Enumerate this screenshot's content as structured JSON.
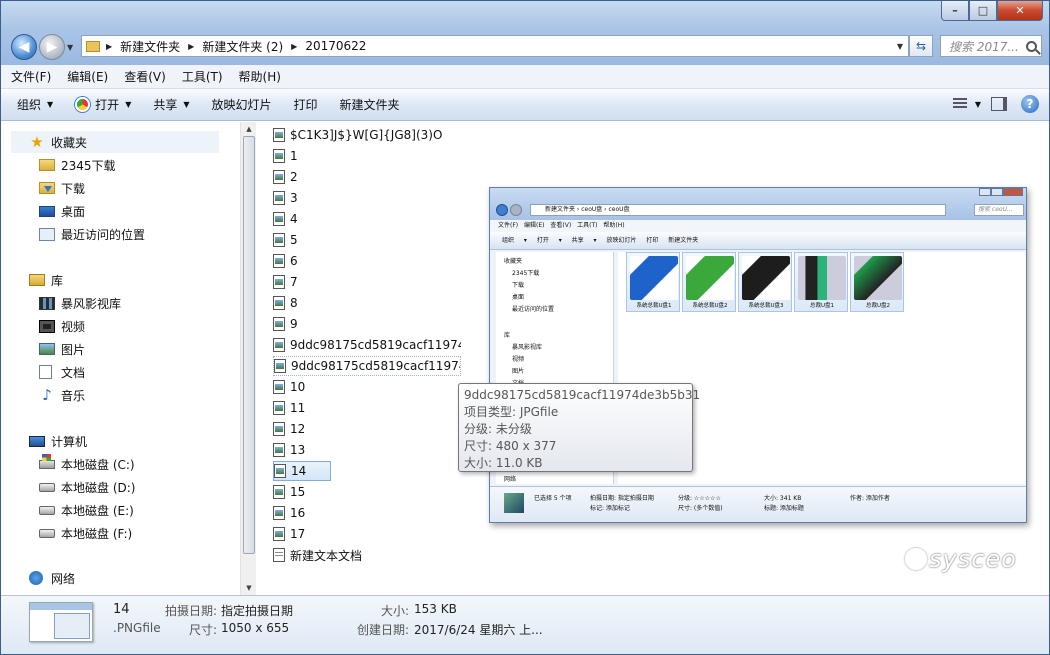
{
  "window": {
    "controls": {
      "minimize": "–",
      "maximize": "□",
      "close": "✕"
    }
  },
  "nav": {
    "back_icon": "back-arrow-icon",
    "forward_icon": "forward-arrow-icon",
    "address": [
      "新建文件夹",
      "新建文件夹 (2)",
      "20170622"
    ],
    "search_placeholder": "搜索 2017..."
  },
  "menu": [
    "文件(F)",
    "编辑(E)",
    "查看(V)",
    "工具(T)",
    "帮助(H)"
  ],
  "commands": {
    "organize": "组织",
    "open": "打开",
    "share": "共享",
    "slideshow": "放映幻灯片",
    "print": "打印",
    "new_folder": "新建文件夹"
  },
  "sidebar": {
    "favorites": {
      "title": "收藏夹",
      "items": [
        "2345下载",
        "下载",
        "桌面",
        "最近访问的位置"
      ]
    },
    "libraries": {
      "title": "库",
      "items": [
        "暴风影视库",
        "视频",
        "图片",
        "文档",
        "音乐"
      ]
    },
    "computer": {
      "title": "计算机",
      "items": [
        "本地磁盘 (C:)",
        "本地磁盘 (D:)",
        "本地磁盘 (E:)",
        "本地磁盘 (F:)"
      ]
    },
    "network": {
      "title": "网络"
    }
  },
  "files": [
    "$C1K3]J$}W[G]{JG8](3)O",
    "1",
    "2",
    "3",
    "4",
    "5",
    "6",
    "7",
    "8",
    "9",
    "9ddc98175cd5819cacf11974c",
    "9ddc98175cd5819cacf11974c",
    "10",
    "11",
    "12",
    "13",
    "14",
    "15",
    "16",
    "17",
    "新建文本文档"
  ],
  "selected_file": "14",
  "tooltip": {
    "name": "9ddc98175cd5819cacf11974de3b5b31",
    "type": "项目类型: JPGfile",
    "rating": "分级: 未分级",
    "dimensions": "尺寸: 480 x 377",
    "size": "大小: 11.0 KB"
  },
  "preview_window": {
    "address": "新建文件夹 › ceoU盘 › ceoU盘",
    "search": "搜索 ceoU...",
    "menu": "文件(F) 编辑(E) 查看(V) 工具(T) 帮助(H)",
    "commands": "组织 ▾   打开 ▾   共享 ▾   放映幻灯片   打印   新建文件夹",
    "nav": [
      "收藏夹",
      "2345下载",
      "下载",
      "桌面",
      "最近访问的位置",
      "库",
      "暴风影视库",
      "视频",
      "图片",
      "文档",
      "网络"
    ],
    "tiles": [
      {
        "label": "系统总裁U盘1",
        "color": "#1e63c9"
      },
      {
        "label": "系统总裁U盘2",
        "color": "#3aa83a"
      },
      {
        "label": "系统总裁U盘3",
        "color": "#1d1d1d"
      },
      {
        "label": "总裁U盘1",
        "color": "#2bb37a"
      },
      {
        "label": "总裁U盘2",
        "color": "#1f9c4a"
      }
    ],
    "status": {
      "selected": "已选择 5 个项",
      "date_label": "拍摄日期: 指定拍摄日期",
      "tag_label": "标记: 添加标记",
      "rating_label": "分级: ☆☆☆☆☆",
      "dims_label": "尺寸: (多个数值)",
      "size_label": "大小: 341 KB",
      "title_label": "标题: 添加标题",
      "author_label": "作者: 添加作者"
    }
  },
  "watermark": "sysceo",
  "status": {
    "name": "14",
    "type": ".PNGfile",
    "date_key": "拍摄日期:",
    "date_val": "指定拍摄日期",
    "dims_key": "尺寸:",
    "dims_val": "1050 x 655",
    "size_key": "大小:",
    "size_val": "153 KB",
    "created_key": "创建日期:",
    "created_val": "2017/6/24 星期六 上..."
  }
}
